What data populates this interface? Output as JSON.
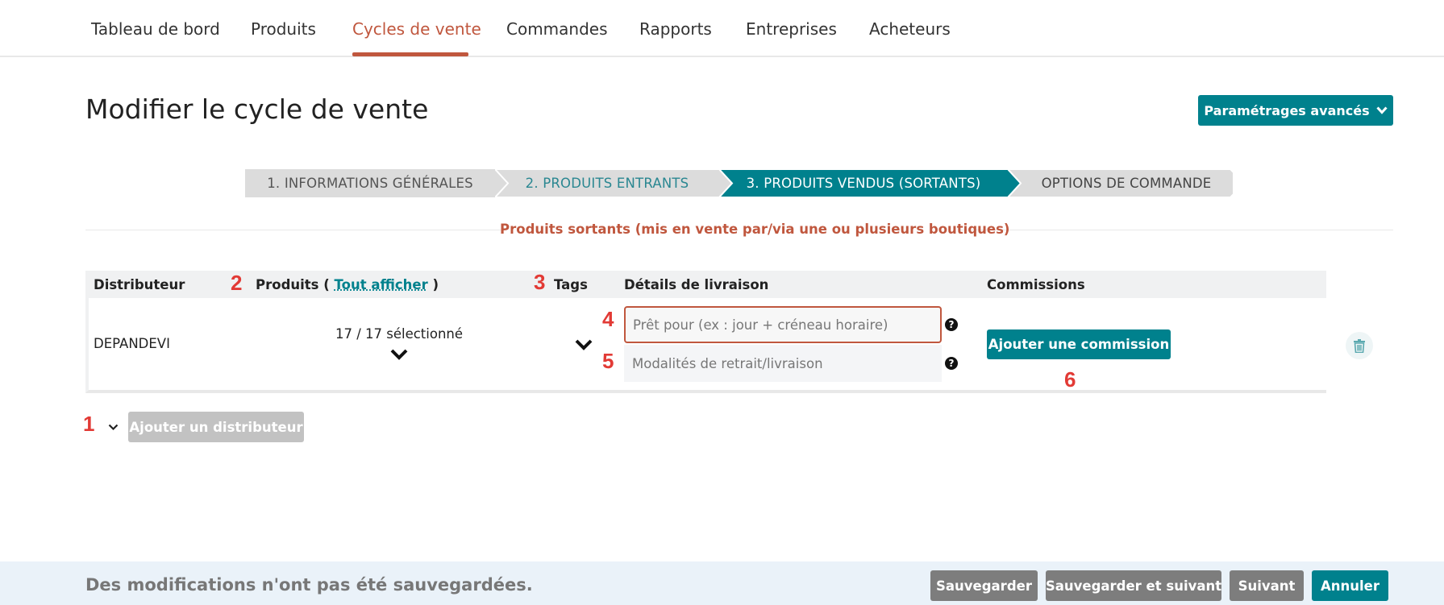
{
  "nav": {
    "items": [
      {
        "label": "Tableau de bord"
      },
      {
        "label": "Produits"
      },
      {
        "label": "Cycles de vente"
      },
      {
        "label": "Commandes"
      },
      {
        "label": "Rapports"
      },
      {
        "label": "Entreprises"
      },
      {
        "label": "Acheteurs"
      }
    ],
    "active": "Cycles de vente"
  },
  "page": {
    "title": "Modifier le cycle de vente",
    "advanced_button": "Paramétrages avancés"
  },
  "steps": [
    {
      "label": "1. INFORMATIONS GÉNÉRALES",
      "state": "done"
    },
    {
      "label": "2. PRODUITS ENTRANTS",
      "state": "link"
    },
    {
      "label": "3. PRODUITS VENDUS (SORTANTS)",
      "state": "active"
    },
    {
      "label": "OPTIONS DE COMMANDE",
      "state": "todo"
    }
  ],
  "section": {
    "label": "Produits sortants (mis en vente par/via une ou plusieurs boutiques)"
  },
  "table": {
    "headers": {
      "distributor": "Distributeur",
      "products": "Produits",
      "products_open": "(",
      "products_link": "Tout afficher",
      "products_close": ")",
      "tags": "Tags",
      "delivery": "Détails de livraison",
      "commissions": "Commissions"
    },
    "rows": [
      {
        "distributor": "DEPANDEVI",
        "products": "17 / 17 sélectionné",
        "ready_for_placeholder": "Prêt pour (ex : jour + créneau horaire)",
        "pickup_placeholder": "Modalités de retrait/livraison",
        "add_commission": "Ajouter une commission"
      }
    ]
  },
  "add_distributor": "Ajouter un distributeur",
  "annotations": [
    "1",
    "2",
    "3",
    "4",
    "5",
    "6"
  ],
  "footer": {
    "message": "Des modifications n'ont pas été sauvegardées.",
    "buttons": {
      "save": "Sauvegarder",
      "save_next": "Sauvegarder et suivant",
      "next": "Suivant",
      "cancel": "Annuler"
    }
  },
  "colors": {
    "accent": "#00818d",
    "active_nav": "#c0573e",
    "annotation": "#e23a35",
    "step_inactive": "#dcdcdc"
  }
}
